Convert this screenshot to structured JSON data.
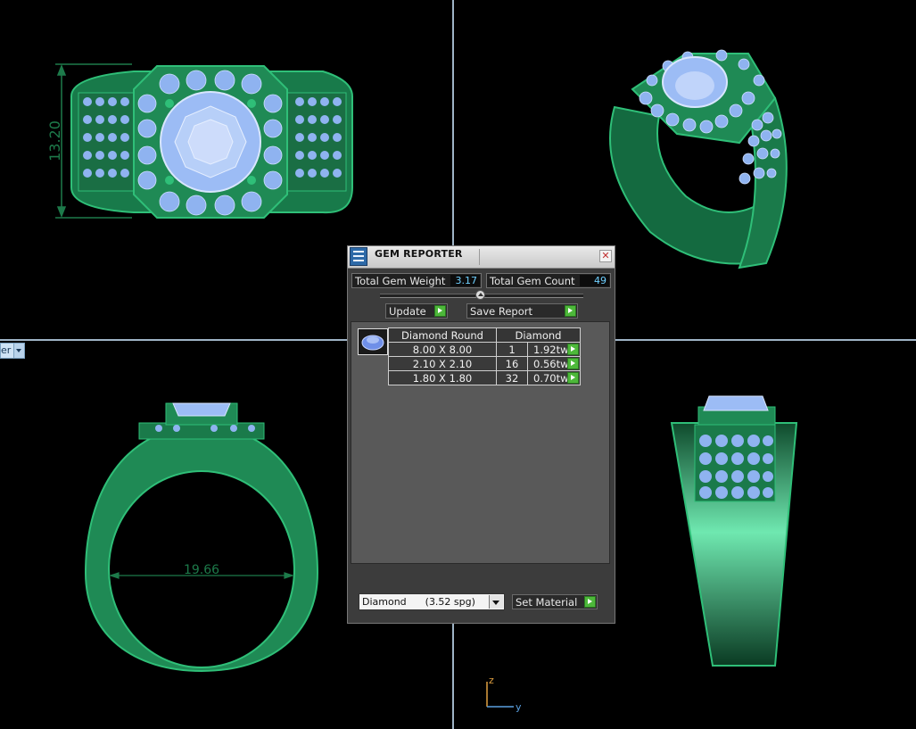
{
  "viewports": {
    "front_dimension": "13.20",
    "side_dimension": "19.66",
    "view_label_fragment": "er"
  },
  "axis": {
    "z_label": "z",
    "y_label": "y"
  },
  "gem_reporter": {
    "title": "GEM REPORTER",
    "close_glyph": "✕",
    "total_weight_label": "Total Gem Weight",
    "total_weight_value": "3.17",
    "total_count_label": "Total Gem Count",
    "total_count_value": "49",
    "update_label": "Update",
    "save_report_label": "Save Report",
    "table": {
      "headers": [
        "Diamond Round",
        "Diamond"
      ],
      "rows": [
        {
          "size": "8.00 X 8.00",
          "count": "1",
          "weight": "1.92tw"
        },
        {
          "size": "2.10 X 2.10",
          "count": "16",
          "weight": "0.56tw"
        },
        {
          "size": "1.80 X 1.80",
          "count": "32",
          "weight": "0.70tw"
        }
      ]
    },
    "material_select_value": "Diamond      (3.52 spg)",
    "set_material_label": "Set Material"
  },
  "colors": {
    "metal_green": "#1f8a55",
    "gem_blue": "#8fb3f0",
    "dimension_green": "#1d7a4a",
    "axis_blue": "#5aa0e0",
    "axis_orange": "#e0a040"
  },
  "icons": [
    "gem-reporter-app-icon",
    "close-icon",
    "go-arrow-icon",
    "diamond-round-thumbnail",
    "dropdown-arrow-icon"
  ]
}
